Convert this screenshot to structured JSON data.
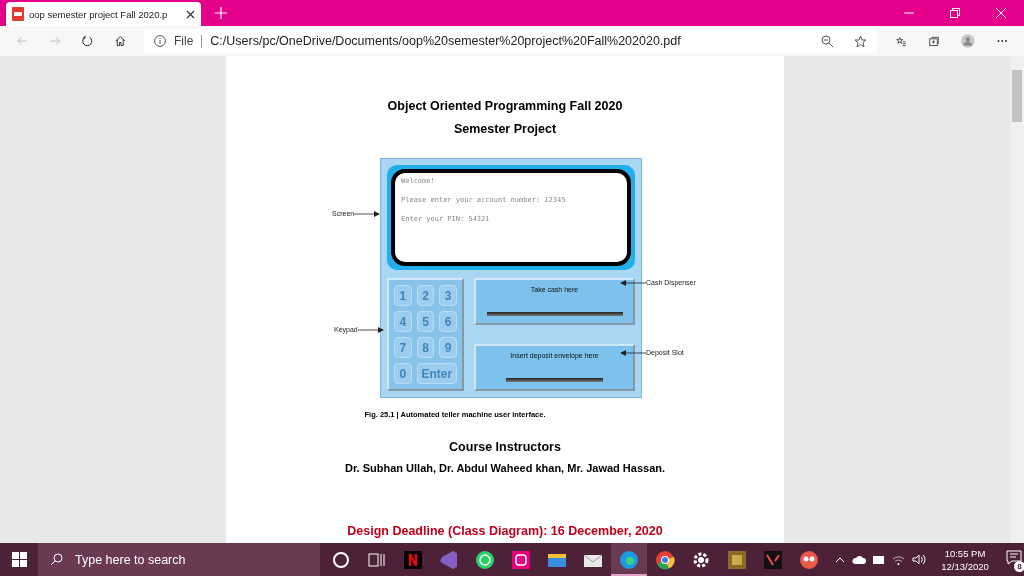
{
  "browser": {
    "tab": {
      "title": "oop semester project Fall 2020.p",
      "selected": true
    },
    "address": {
      "scheme": "File",
      "url": "C:/Users/pc/OneDrive/Documents/oop%20semester%20project%20Fall%202020.pdf"
    }
  },
  "document": {
    "title": "Object Oriented Programming Fall 2020",
    "subtitle": "Semester Project",
    "figure": {
      "screen_lines": [
        "Welcome!",
        "Please enter your account number: 12345",
        "Enter your PIN: 54321"
      ],
      "keypad_keys": [
        "1",
        "2",
        "3",
        "4",
        "5",
        "6",
        "7",
        "8",
        "9",
        "0",
        "Enter"
      ],
      "cash_slot": "Take cash here",
      "deposit_slot": "Insert deposit envelope here",
      "callouts": [
        {
          "label": "Screen",
          "kind": "screen"
        },
        {
          "label": "Keypad",
          "kind": "keypad"
        },
        {
          "label": "Cash Dispenser",
          "kind": "cash"
        },
        {
          "label": "Deposit Slot",
          "kind": "deposit"
        }
      ],
      "caption": "Fig. 25.1 | Automated teller machine user interface."
    },
    "instructors_heading": "Course Instructors",
    "instructors": "Dr. Subhan Ullah, Dr. Abdul Waheed khan, Mr. Jawad Hassan.",
    "deadline": "Design Deadline (Class Diagram): 16 December, 2020"
  },
  "taskbar": {
    "search_placeholder": "Type here to search",
    "time": "10:55 PM",
    "date": "12/13/2020",
    "notification_count": "8"
  }
}
